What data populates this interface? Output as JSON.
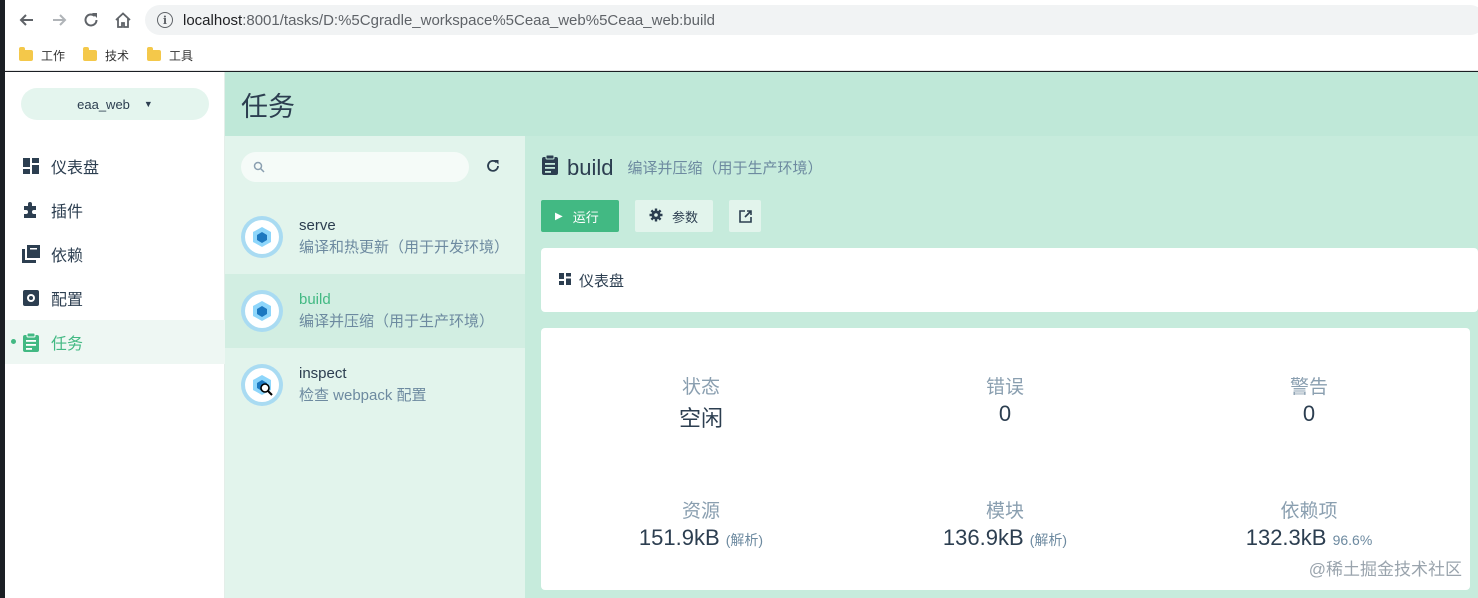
{
  "browser": {
    "url_host": "localhost",
    "url_path": ":8001/tasks/D:%5Cgradle_workspace%5Ceaa_web%5Ceaa_web:build",
    "bookmarks": [
      "工作",
      "技术",
      "工具"
    ]
  },
  "sidebar": {
    "project": "eaa_web",
    "items": [
      {
        "label": "仪表盘",
        "icon": "dashboard-icon"
      },
      {
        "label": "插件",
        "icon": "puzzle-icon"
      },
      {
        "label": "依赖",
        "icon": "library-icon"
      },
      {
        "label": "配置",
        "icon": "settings-icon"
      },
      {
        "label": "任务",
        "icon": "clipboard-icon",
        "active": true
      }
    ]
  },
  "page": {
    "title": "任务"
  },
  "tasks": [
    {
      "name": "serve",
      "desc": "编译和热更新（用于开发环境）"
    },
    {
      "name": "build",
      "desc": "编译并压缩（用于生产环境）",
      "selected": true
    },
    {
      "name": "inspect",
      "desc": "检查 webpack 配置"
    }
  ],
  "detail": {
    "name": "build",
    "desc": "编译并压缩（用于生产环境）",
    "run_label": "运行",
    "params_label": "参数",
    "dashboard_label": "仪表盘"
  },
  "stats": {
    "status": {
      "label": "状态",
      "value": "空闲"
    },
    "errors": {
      "label": "错误",
      "value": "0"
    },
    "warnings": {
      "label": "警告",
      "value": "0"
    },
    "assets": {
      "label": "资源",
      "value": "151.9kB",
      "note": "(解析)"
    },
    "modules": {
      "label": "模块",
      "value": "136.9kB",
      "note": "(解析)"
    },
    "deps": {
      "label": "依赖项",
      "value": "132.3kB",
      "note": "96.6%"
    }
  },
  "watermark": "@稀土掘金技术社区",
  "colors": {
    "accent": "#42b983",
    "header": "#bfe8d8"
  }
}
